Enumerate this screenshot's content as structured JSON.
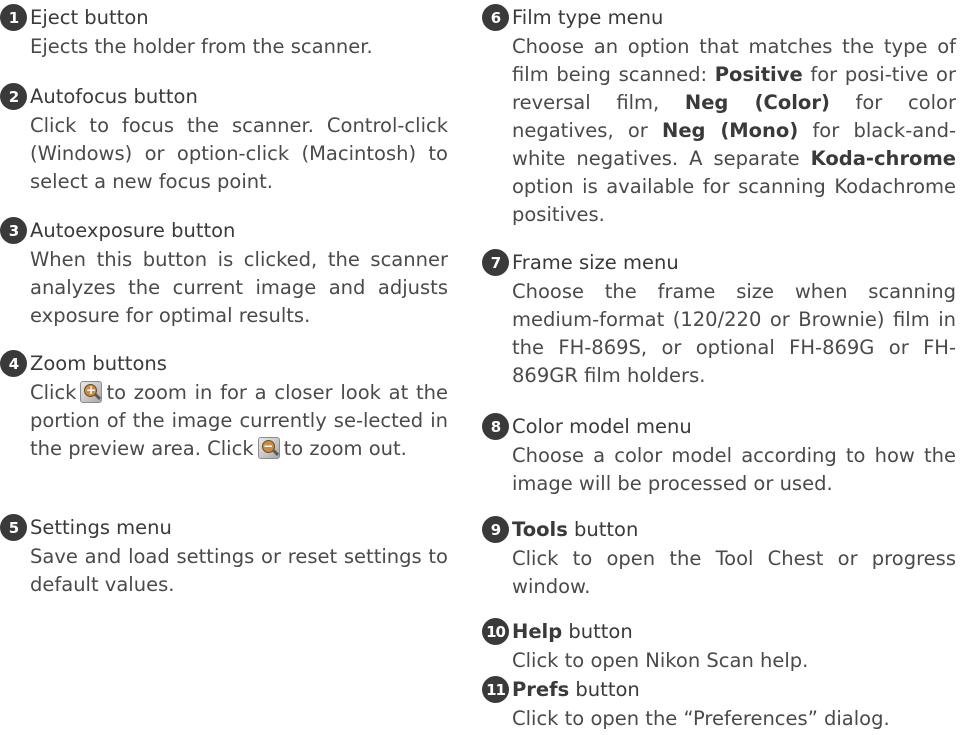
{
  "items": [
    {
      "num": "1",
      "title": "Eject button",
      "body": [
        "Ejects the holder from the scanner."
      ]
    },
    {
      "num": "2",
      "title": "Autofocus button",
      "body": [
        "Click to focus the scanner.  Control-click (Windows) or option-click (Macintosh) to select a new focus point."
      ]
    },
    {
      "num": "3",
      "title": "Autoexposure button",
      "body": [
        "When this button is clicked, the scanner analyzes the current image and adjusts exposure for optimal results."
      ]
    },
    {
      "num": "4",
      "title": "Zoom buttons",
      "body": [
        "Click",
        "to zoom in for a closer look at the portion of the image currently se-lected in the preview area.  Click",
        "to zoom out."
      ],
      "icons": [
        "zoom-in-icon",
        "zoom-out-icon"
      ]
    },
    {
      "num": "5",
      "title": "Settings menu",
      "body": [
        "Save and load settings or reset settings to default values."
      ]
    },
    {
      "num": "6",
      "title": "Film type menu",
      "body": [
        "Choose an option that matches the type of film being scanned: ",
        "Positive",
        " for posi-tive or reversal film, ",
        "Neg (Color)",
        " for color negatives, or ",
        "Neg (Mono)",
        " for black-and-white negatives.  A separate ",
        "Koda-chrome",
        " option is available for scanning Kodachrome positives."
      ]
    },
    {
      "num": "7",
      "title": "Frame size menu",
      "body": [
        "Choose the frame size when scanning medium-format (120/220 or Brownie) film in the FH-869S, or optional FH-869G or FH-869GR film holders."
      ]
    },
    {
      "num": "8",
      "title": "Color model menu",
      "body": [
        "Choose a color model according to how the image will be processed or used."
      ]
    },
    {
      "num": "9",
      "title_bold": "Tools",
      "title_rest": " button",
      "body": [
        "Click to open the Tool Chest or progress window."
      ]
    },
    {
      "num": "10",
      "title_bold": "Help",
      "title_rest": " button",
      "body": [
        "Click to open Nikon Scan help."
      ]
    },
    {
      "num": "11",
      "title_bold": "Prefs",
      "title_rest": " button",
      "body": [
        "Click to open the “Preferences” dialog."
      ]
    }
  ]
}
